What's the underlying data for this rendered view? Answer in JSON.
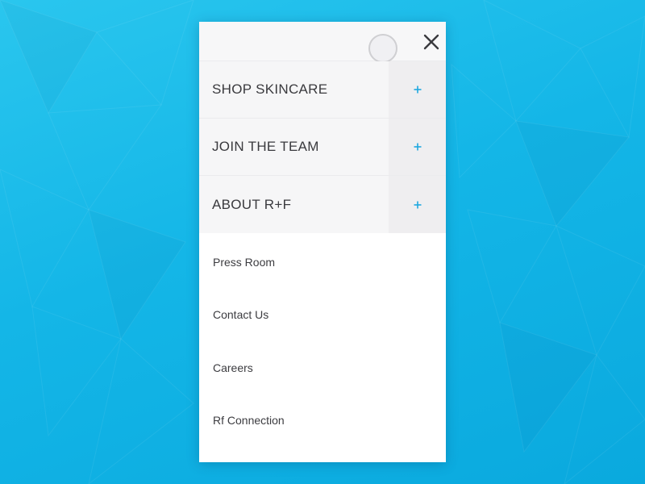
{
  "menu": {
    "items": [
      {
        "label": "SHOP SKINCARE",
        "expand_glyph": "+"
      },
      {
        "label": "JOIN THE TEAM",
        "expand_glyph": "+"
      },
      {
        "label": "ABOUT R+F",
        "expand_glyph": "+"
      }
    ],
    "sub_links": [
      {
        "label": "Press Room"
      },
      {
        "label": "Contact Us"
      },
      {
        "label": "Careers"
      },
      {
        "label": "Rf Connection"
      }
    ]
  },
  "icons": {
    "close": "close-icon",
    "expand": "plus-icon"
  },
  "colors": {
    "background": "#14b4e6",
    "accent": "#1fa8e0",
    "panel": "#ffffff",
    "menu_item_bg": "#f6f6f7",
    "text": "#3a3a3e"
  }
}
